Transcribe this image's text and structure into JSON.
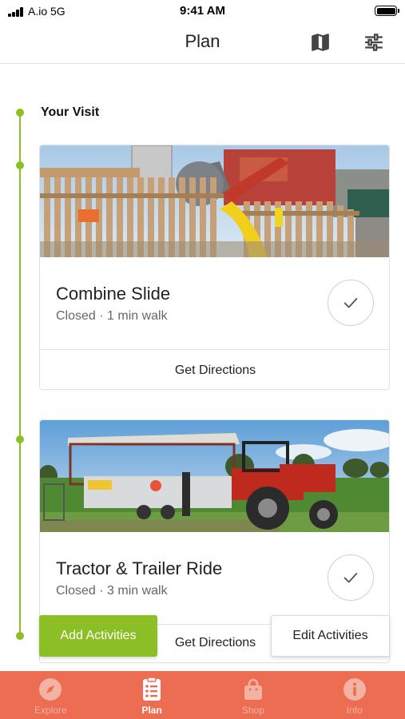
{
  "status_bar": {
    "carrier": "A.io  5G",
    "time": "9:41 AM"
  },
  "nav": {
    "title": "Plan",
    "icons": [
      "map-icon",
      "filter-sliders-icon"
    ]
  },
  "section": {
    "title": "Your Visit"
  },
  "activities": [
    {
      "name": "Combine Slide",
      "status": "Closed · 1 min walk",
      "directions_label": "Get Directions",
      "image": "wooden-fence-playground-slide"
    },
    {
      "name": "Tractor & Trailer Ride",
      "status": "Closed · 3 min walk",
      "directions_label": "Get Directions",
      "image": "red-tractor-with-trailer-in-field"
    }
  ],
  "actions": {
    "add_label": "Add Activities",
    "edit_label": "Edit Activities"
  },
  "tabs": [
    {
      "label": "Explore",
      "icon": "compass-icon",
      "active": false
    },
    {
      "label": "Plan",
      "icon": "checklist-icon",
      "active": true
    },
    {
      "label": "Shop",
      "icon": "shopping-bag-icon",
      "active": false
    },
    {
      "label": "Info",
      "icon": "info-icon",
      "active": false
    }
  ],
  "colors": {
    "accent_green": "#8cbf26",
    "tab_bar": "#ec6d52",
    "tab_inactive": "#f4b2a3",
    "tab_active": "#ffffff"
  }
}
